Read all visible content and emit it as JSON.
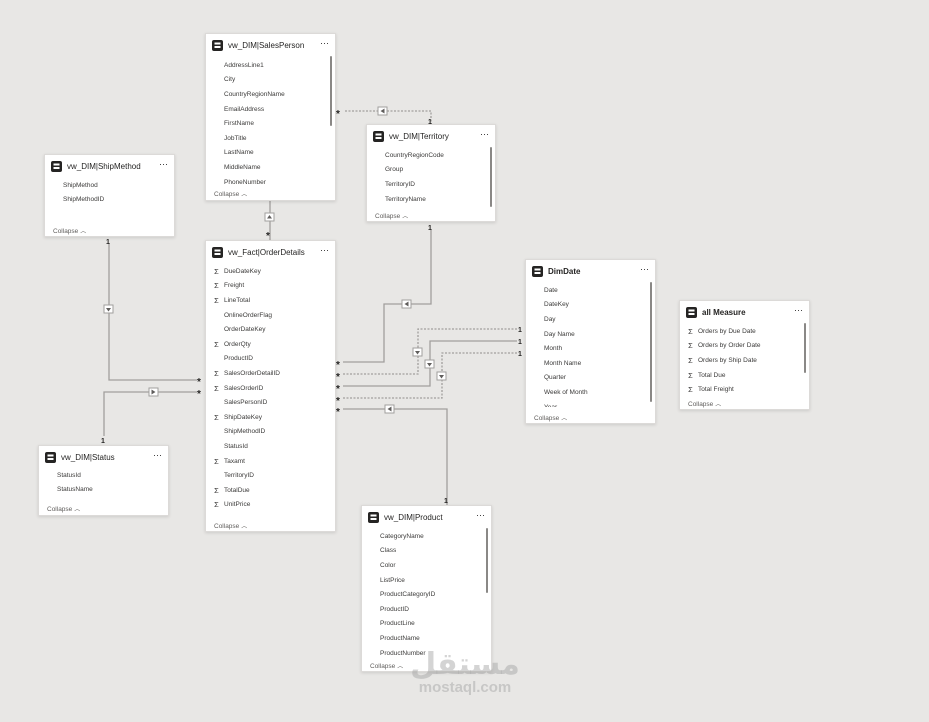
{
  "tables": {
    "salesperson": {
      "title": "vw_DIM|SalesPerson",
      "fields": [
        "AddressLine1",
        "City",
        "CountryRegionName",
        "EmailAddress",
        "FirstName",
        "JobTitle",
        "LastName",
        "MiddleName",
        "PhoneNumber"
      ],
      "collapse": "Collapse"
    },
    "territory": {
      "title": "vw_DIM|Territory",
      "fields": [
        "CountryRegionCode",
        "Group",
        "TerritoryID",
        "TerritoryName"
      ],
      "collapse": "Collapse"
    },
    "shipmethod": {
      "title": "vw_DIM|ShipMethod",
      "fields": [
        "ShipMethod",
        "ShipMethodID"
      ],
      "collapse": "Collapse"
    },
    "orderdetails": {
      "title": "vw_Fact|OrderDetails",
      "fields": [
        {
          "name": "DueDateKey",
          "sigma": true
        },
        {
          "name": "Freight",
          "sigma": true
        },
        {
          "name": "LineTotal",
          "sigma": true
        },
        {
          "name": "OnlineOrderFlag",
          "sigma": false
        },
        {
          "name": "OrderDateKey",
          "sigma": false
        },
        {
          "name": "OrderQty",
          "sigma": true
        },
        {
          "name": "ProductID",
          "sigma": false
        },
        {
          "name": "SalesOrderDetailID",
          "sigma": true
        },
        {
          "name": "SalesOrderID",
          "sigma": true
        },
        {
          "name": "SalesPersonID",
          "sigma": false
        },
        {
          "name": "ShipDateKey",
          "sigma": true
        },
        {
          "name": "ShipMethodID",
          "sigma": false
        },
        {
          "name": "StatusId",
          "sigma": false
        },
        {
          "name": "Taxamt",
          "sigma": true
        },
        {
          "name": "TerritoryID",
          "sigma": false
        },
        {
          "name": "TotalDue",
          "sigma": true
        },
        {
          "name": "UnitPrice",
          "sigma": true
        }
      ],
      "collapse": "Collapse"
    },
    "dimdate": {
      "title": "DimDate",
      "fields": [
        "Date",
        "DateKey",
        "Day",
        "Day Name",
        "Month",
        "Month Name",
        "Quarter",
        "Week of Month",
        "Year"
      ],
      "collapse": "Collapse"
    },
    "allmeasure": {
      "title": "all Measure",
      "fields": [
        "Orders by Due Date",
        "Orders by Order Date",
        "Orders by Ship Date",
        "Total Due",
        "Total Freight"
      ],
      "collapse": "Collapse"
    },
    "status": {
      "title": "vw_DIM|Status",
      "fields": [
        "StatusId",
        "StatusName"
      ],
      "collapse": "Collapse"
    },
    "product": {
      "title": "vw_DIM|Product",
      "fields": [
        "CategoryName",
        "Class",
        "Color",
        "ListPrice",
        "ProductCategoryID",
        "ProductID",
        "ProductLine",
        "ProductName",
        "ProductNumber"
      ],
      "collapse": "Collapse"
    }
  },
  "relationship_labels": {
    "one": "1",
    "many": "*"
  },
  "more_label": "···",
  "watermark": {
    "arabic": "مستقل",
    "latin": "mostaql.com"
  }
}
